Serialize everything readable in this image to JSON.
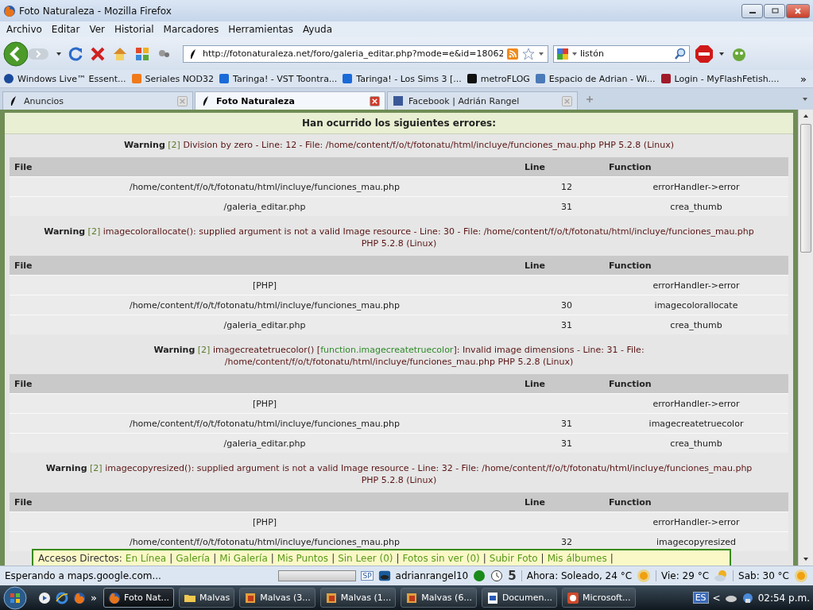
{
  "window": {
    "title": "Foto Naturaleza - Mozilla Firefox"
  },
  "menu": [
    "Archivo",
    "Editar",
    "Ver",
    "Historial",
    "Marcadores",
    "Herramientas",
    "Ayuda"
  ],
  "nav": {
    "url": "http://fotonaturaleza.net/foro/galeria_editar.php?mode=e&id=18062",
    "search": "listón"
  },
  "bookmarks": [
    {
      "label": "Windows Live™ Essent..."
    },
    {
      "label": "Seriales NOD32"
    },
    {
      "label": "Taringa! - VST Toontra..."
    },
    {
      "label": "Taringa! - Los Sims 3 [..."
    },
    {
      "label": "metroFLOG"
    },
    {
      "label": "Espacio de Adrian - Wi..."
    },
    {
      "label": "Login - MyFlashFetish...."
    }
  ],
  "bookmarks_more": "»",
  "tabs": [
    {
      "label": "Anuncios",
      "selected": false
    },
    {
      "label": "Foto Naturaleza",
      "selected": true
    },
    {
      "label": "Facebook | Adrián Rangel",
      "selected": false
    }
  ],
  "page": {
    "heading": "Han ocurrido los siguientes errores:",
    "errors": [
      {
        "label": "Warning",
        "code": "[2]",
        "text": "Division by zero - Line: 12 - File: /home/content/f/o/t/fotonatu/html/incluye/funciones_mau.php PHP 5.2.8 (Linux)",
        "table": {
          "columns": [
            "File",
            "Line",
            "Function"
          ],
          "rows": [
            [
              "/home/content/f/o/t/fotonatu/html/incluye/funciones_mau.php",
              "12",
              "errorHandler->error"
            ],
            [
              "/galeria_editar.php",
              "31",
              "crea_thumb"
            ]
          ]
        }
      },
      {
        "label": "Warning",
        "code": "[2]",
        "text": "imagecolorallocate(): supplied argument is not a valid Image resource - Line: 30 - File: /home/content/f/o/t/fotonatu/html/incluye/funciones_mau.php PHP 5.2.8 (Linux)",
        "table": {
          "columns": [
            "File",
            "Line",
            "Function"
          ],
          "rows": [
            [
              "[PHP]",
              "",
              "errorHandler->error"
            ],
            [
              "/home/content/f/o/t/fotonatu/html/incluye/funciones_mau.php",
              "30",
              "imagecolorallocate"
            ],
            [
              "/galeria_editar.php",
              "31",
              "crea_thumb"
            ]
          ]
        }
      },
      {
        "label": "Warning",
        "code": "[2]",
        "text": "imagecreatetruecolor() [",
        "link": "function.imagecreatetruecolor",
        "text_after": "]: Invalid image dimensions - Line: 31 - File: /home/content/f/o/t/fotonatu/html/incluye/funciones_mau.php PHP 5.2.8 (Linux)",
        "table": {
          "columns": [
            "File",
            "Line",
            "Function"
          ],
          "rows": [
            [
              "[PHP]",
              "",
              "errorHandler->error"
            ],
            [
              "/home/content/f/o/t/fotonatu/html/incluye/funciones_mau.php",
              "31",
              "imagecreatetruecolor"
            ],
            [
              "/galeria_editar.php",
              "31",
              "crea_thumb"
            ]
          ]
        }
      },
      {
        "label": "Warning",
        "code": "[2]",
        "text": "imagecopyresized(): supplied argument is not a valid Image resource - Line: 32 - File: /home/content/f/o/t/fotonatu/html/incluye/funciones_mau.php PHP 5.2.8 (Linux)",
        "table": {
          "columns": [
            "File",
            "Line",
            "Function"
          ],
          "rows": [
            [
              "[PHP]",
              "",
              "errorHandler->error"
            ],
            [
              "/home/content/f/o/t/fotonatu/html/incluye/funciones_mau.php",
              "32",
              "imagecopyresized"
            ]
          ]
        }
      }
    ]
  },
  "shortcuts": {
    "label": "Accesos Directos:",
    "separator": "|",
    "links": [
      "En Línea",
      "Galería",
      "Mi Galería",
      "Mis Puntos",
      "Sin Leer (0)",
      "Fotos sin ver (0)",
      "Subir Foto",
      "Mis álbumes"
    ]
  },
  "status_bar": {
    "text": "Esperando a maps.google.com...",
    "progress": {
      "level": 0
    },
    "sp": "SP",
    "user": "adrianrangel10",
    "count": "5",
    "weather": [
      {
        "text": "Ahora: Soleado, 24 °C"
      },
      {
        "text": "Vie: 29 °C"
      },
      {
        "text": "Sab: 30 °C"
      }
    ]
  },
  "taskbar": {
    "more": "»",
    "tasks": [
      {
        "label": "Foto Nat...",
        "selected": true
      },
      {
        "label": "Malvas",
        "selected": false
      },
      {
        "label": "Malvas (3...",
        "selected": false
      },
      {
        "label": "Malvas (1...",
        "selected": false
      },
      {
        "label": "Malvas (6...",
        "selected": false
      },
      {
        "label": "Documen...",
        "selected": false
      },
      {
        "label": "Microsoft...",
        "selected": false
      }
    ],
    "lang": "ES",
    "arrow": "<",
    "time": "02:54 p.m."
  }
}
